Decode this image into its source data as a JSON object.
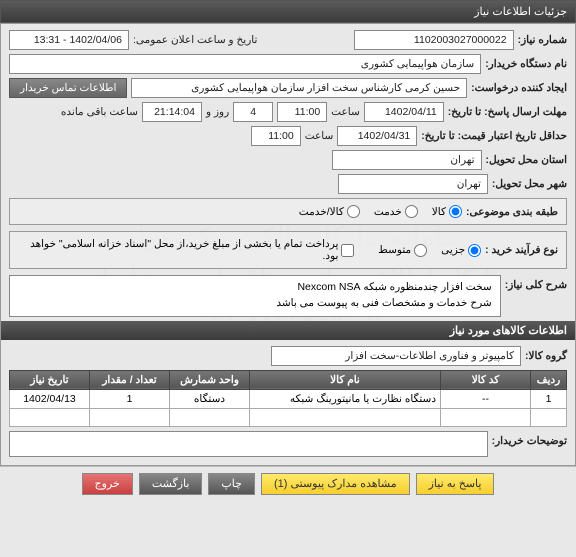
{
  "window": {
    "title": "جزئیات اطلاعات نیاز"
  },
  "fields": {
    "need_no_label": "شماره نیاز:",
    "need_no": "1102003027000022",
    "announce_label": "تاریخ و ساعت اعلان عمومی:",
    "announce_value": "1402/04/06 - 13:31",
    "buyer_label": "نام دستگاه خریدار:",
    "buyer_value": "سازمان هواپیمایی کشوری",
    "requester_label": "ایجاد کننده درخواست:",
    "requester_value": "حسین کرمی کارشناس سخت افزار سازمان هواپیمایی کشوری",
    "contact_button": "اطلاعات تماس خریدار",
    "deadline_label": "مهلت ارسال پاسخ: تا تاریخ:",
    "deadline_date": "1402/04/11",
    "time_label": "ساعت",
    "deadline_time": "11:00",
    "days_label": "روز و",
    "days_value": "4",
    "countdown": "21:14:04",
    "remaining_label": "ساعت باقی مانده",
    "validity_label": "حداقل تاریخ اعتبار قیمت: تا تاریخ:",
    "validity_date": "1402/04/31",
    "validity_time": "11:00",
    "exec_city_label": "استان محل تحویل:",
    "exec_city": "تهران",
    "deliver_city_label": "شهر محل تحویل:",
    "deliver_city": "تهران"
  },
  "classify": {
    "label": "طبقه بندی موضوعی:",
    "options": [
      "کالا",
      "خدمت",
      "کالا/خدمت"
    ],
    "selected": 0
  },
  "process": {
    "label": "نوع فرآیند خرید :",
    "options": [
      "جزیی",
      "متوسط"
    ],
    "selected": 0,
    "note_checkbox": "پرداخت تمام یا بخشی از مبلغ خرید،از محل \"اسناد خزانه اسلامی\" خواهد بود."
  },
  "overview": {
    "label": "شرح کلی نیاز:",
    "line1": "سخت افزار چندمنظوره شبکه Nexcom NSA",
    "line2": "شرح خدمات و مشخصات فنی به پیوست می باشد"
  },
  "goods_section": "اطلاعات کالاهای مورد نیاز",
  "group": {
    "label": "گروه کالا:",
    "value": "کامپیوتر و فناوری اطلاعات-سخت افزار"
  },
  "table": {
    "headers": [
      "ردیف",
      "کد کالا",
      "نام کالا",
      "واحد شمارش",
      "تعداد / مقدار",
      "تاریخ نیاز"
    ],
    "rows": [
      {
        "idx": "1",
        "code": "--",
        "name": "دستگاه نظارت یا مانیتورینگ شبکه",
        "unit": "دستگاه",
        "qty": "1",
        "date": "1402/04/13"
      }
    ]
  },
  "buyer_notes_label": "توضیحات خریدار:",
  "footer": {
    "respond": "پاسخ به نیاز",
    "attachments": "مشاهده مدارک پیوستی (1)",
    "print": "چاپ",
    "back": "بازگشت",
    "exit": "خروج"
  },
  "watermark": {
    "l1": "سامانه تدارکات الکترونیکی دولت",
    "l2": "پایگاه اطلاع رسانی مناقصات و مزایدات",
    "l3": "۰۲۱-۸۸۳۴۹۶۷۰-۵"
  }
}
